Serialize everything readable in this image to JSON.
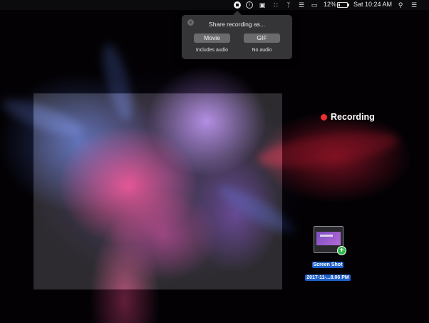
{
  "menubar": {
    "battery_percent": "12%",
    "clock": "Sat 10:24 AM"
  },
  "share_popover": {
    "title": "Share recording as...",
    "movie_button": "Movie",
    "movie_caption": "Includes audio",
    "gif_button": "GIF",
    "gif_caption": "No audio"
  },
  "recording": {
    "label": "Recording",
    "dot_color": "#e8302e"
  },
  "desktop_file": {
    "name_line1": "Screen Shot",
    "name_line2": "2017-11-...8.06 PM"
  },
  "icons": [
    "stop-recording-icon",
    "info-icon",
    "camera-icon",
    "grid-icon",
    "bluetooth-icon",
    "wifi-icon",
    "airplay-icon",
    "battery-icon",
    "search-icon",
    "list-icon",
    "close-icon",
    "plus-icon"
  ]
}
